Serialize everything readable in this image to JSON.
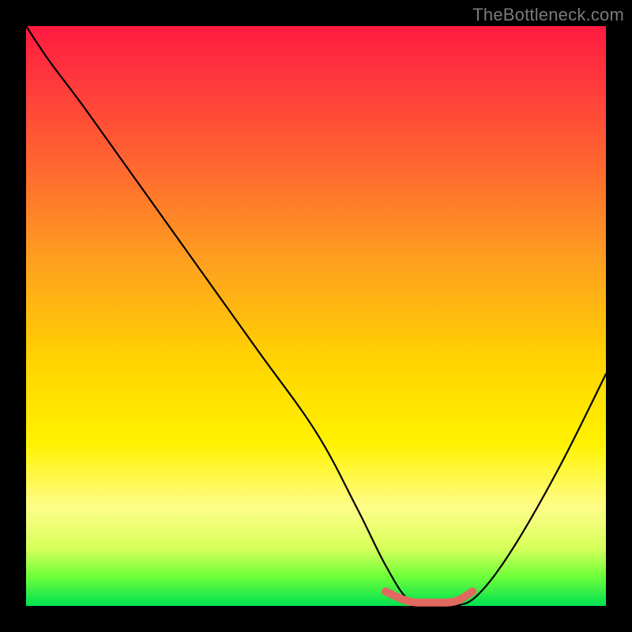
{
  "watermark": "TheBottleneck.com",
  "chart_data": {
    "type": "line",
    "title": "",
    "xlabel": "",
    "ylabel": "",
    "xlim": [
      0,
      100
    ],
    "ylim": [
      0,
      100
    ],
    "grid": false,
    "legend": false,
    "series": [
      {
        "name": "bottleneck-curve",
        "x": [
          0,
          4,
          10,
          20,
          30,
          40,
          50,
          57,
          62,
          66,
          70,
          74,
          78,
          84,
          92,
          100
        ],
        "values": [
          100,
          94,
          86,
          72,
          58,
          44,
          30,
          17,
          7,
          1,
          0,
          0,
          2,
          10,
          24,
          40
        ]
      }
    ],
    "highlight": {
      "name": "optimal-range",
      "x": [
        62,
        66,
        70,
        74,
        77
      ],
      "values": [
        2.5,
        0.8,
        0.6,
        0.8,
        2.5
      ]
    },
    "background_gradient": {
      "stops": [
        {
          "pos": 0,
          "color": "#ff1a40"
        },
        {
          "pos": 25,
          "color": "#ff6a2f"
        },
        {
          "pos": 58,
          "color": "#ffd400"
        },
        {
          "pos": 83,
          "color": "#fffd8a"
        },
        {
          "pos": 100,
          "color": "#00e050"
        }
      ]
    }
  }
}
